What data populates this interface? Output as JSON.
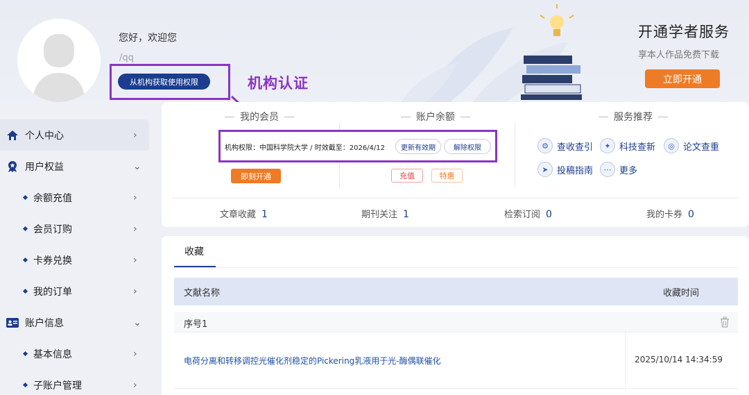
{
  "profile": {
    "greeting": "您好，欢迎您",
    "user_id": "/qq",
    "auth_button": "从机构获取使用权限",
    "auth_annotation": "机构认证"
  },
  "promo": {
    "title": "开通学者服务",
    "subtitle": "享本人作品免费下载",
    "button": "立即开通"
  },
  "sidebar": {
    "items": [
      {
        "label": "个人中心",
        "icon": "home-icon",
        "chevron": "›"
      },
      {
        "label": "用户权益",
        "icon": "badge-icon",
        "chevron": "⌄"
      },
      {
        "label": "余额充值",
        "chevron": "›"
      },
      {
        "label": "会员订购",
        "chevron": "›"
      },
      {
        "label": "卡券兑换",
        "chevron": "›"
      },
      {
        "label": "我的订单",
        "chevron": "›"
      },
      {
        "label": "账户信息",
        "icon": "id-card-icon",
        "chevron": "⌄"
      },
      {
        "label": "基本信息",
        "chevron": "›"
      },
      {
        "label": "子账户管理",
        "chevron": "›"
      }
    ]
  },
  "membership": {
    "title": "我的会员",
    "institution_text": "机构权限：中国科学院大学 / 时效截至：2026/4/12",
    "renew_button": "更新有效期",
    "revoke_button": "解除权限",
    "open_button": "即刻开通"
  },
  "balance": {
    "title": "账户余额",
    "recharge_button": "充值",
    "special_button": "特惠"
  },
  "services": {
    "title": "服务推荐",
    "items": [
      {
        "label": "查收查引",
        "icon": "gear-search-icon"
      },
      {
        "label": "科技查新",
        "icon": "bulb-icon"
      },
      {
        "label": "论文查重",
        "icon": "check-doc-icon"
      },
      {
        "label": "投稿指南",
        "icon": "send-icon"
      },
      {
        "label": "更多",
        "icon": "more-icon"
      }
    ]
  },
  "stats": [
    {
      "label": "文章收藏",
      "value": "1"
    },
    {
      "label": "期刊关注",
      "value": "1"
    },
    {
      "label": "检索订阅",
      "value": "0"
    },
    {
      "label": "我的卡券",
      "value": "0"
    }
  ],
  "favorites": {
    "tab": "收藏",
    "col_name": "文献名称",
    "col_time": "收藏时间",
    "group_label": "序号1",
    "rows": [
      {
        "title": "电荷分离和转移调控光催化剂稳定的Pickering乳液用于光-酶偶联催化",
        "time": "2025/10/14 14:34:59"
      }
    ]
  },
  "colors": {
    "accent": "#1b3d8f",
    "orange": "#ee7b25",
    "annotation": "#8a35c2"
  }
}
